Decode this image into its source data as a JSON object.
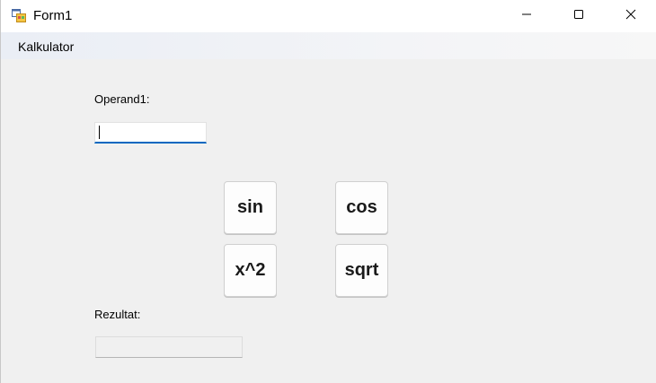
{
  "window": {
    "title": "Form1",
    "icon": "winforms-app-icon",
    "controls": {
      "minimize_icon": "minimize-icon",
      "maximize_icon": "maximize-icon",
      "close_icon": "close-icon"
    }
  },
  "menu": {
    "items": [
      {
        "label": "Kalkulator"
      }
    ]
  },
  "form": {
    "operand1_label": "Operand1:",
    "operand1_value": "",
    "result_label": "Rezultat:",
    "result_value": "",
    "buttons": {
      "sin": "sin",
      "cos": "cos",
      "square": "x^2",
      "sqrt": "sqrt"
    }
  },
  "colors": {
    "accent": "#0067c0",
    "window_bg": "#f0f0f0",
    "titlebar_bg": "#ffffff"
  }
}
